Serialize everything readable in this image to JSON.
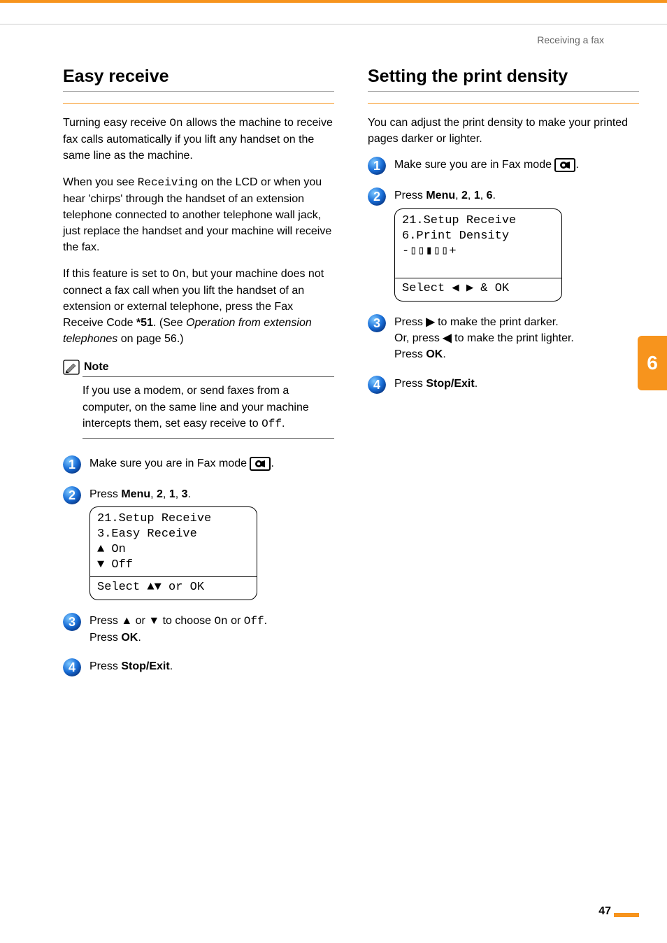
{
  "header": {
    "section": "Receiving a fax"
  },
  "left": {
    "title": "Easy receive",
    "p1a": "Turning easy receive ",
    "p1_on": "On",
    "p1b": " allows the machine to receive fax calls automatically if you lift any handset on the same line as the machine.",
    "p2a": "When you see ",
    "p2_rcv": "Receiving",
    "p2b": " on the LCD or when you hear 'chirps' through the handset of an extension telephone connected to another telephone wall jack, just replace the handset and your machine will receive the fax.",
    "p3a": "If this feature is set to ",
    "p3_on": "On",
    "p3b": ", but your machine does not connect a fax call when you lift the handset of an extension or external telephone, press the Fax Receive Code ",
    "p3_code": "*51",
    "p3c": ". (See ",
    "p3_link": "Operation from extension telephones",
    "p3d": " on page 56.)",
    "note_label": "Note",
    "note_a": "If you use a modem, or send faxes from a computer, on the same line and your machine intercepts them, set easy receive to ",
    "note_off": "Off",
    "note_b": ".",
    "s1": "Make sure you are in Fax mode ",
    "s2a": "Press ",
    "s2_menu": "Menu",
    "s2b": ", ",
    "s2_2": "2",
    "s2c": ", ",
    "s2_1": "1",
    "s2d": ", ",
    "s2_3": "3",
    "s2e": ".",
    "lcd1_l1": "21.Setup Receive",
    "lcd1_l2": "  3.Easy Receive",
    "lcd1_l3": "▲    On",
    "lcd1_l4": "▼    Off",
    "lcd1_l5": "Select ▲▼ or OK",
    "s3a": "Press ",
    "s3_up": "▲",
    "s3b": " or ",
    "s3_dn": "▼",
    "s3c": " to choose ",
    "s3_on": "On",
    "s3d": " or ",
    "s3_off": "Off",
    "s3e": ".",
    "s3f": "Press ",
    "s3_ok": "OK",
    "s3g": ".",
    "s4a": "Press ",
    "s4_stop": "Stop/Exit",
    "s4b": "."
  },
  "right": {
    "title": "Setting the print density",
    "p1": "You can adjust the print density to make your printed pages darker or lighter.",
    "s1": "Make sure you are in Fax mode ",
    "s2a": " Press ",
    "s2_menu": "Menu",
    "s2b": ", ",
    "s2_2": "2",
    "s2c": ", ",
    "s2_1": "1",
    "s2d": ", ",
    "s2_6": "6",
    "s2e": ".",
    "lcd_l1": "21.Setup Receive",
    "lcd_l2": "  6.Print Density",
    "lcd_l3": "      -▯▯▮▯▯+",
    "lcd_l4": "Select ◀ ▶ & OK",
    "s3a": "Press ",
    "s3_r": "▶",
    "s3b": " to make the print darker.",
    "s3c": "Or, press ",
    "s3_l": "◀",
    "s3d": " to make the print lighter.",
    "s3e": "Press ",
    "s3_ok": "OK",
    "s3f": ".",
    "s4a": "Press ",
    "s4_stop": "Stop/Exit",
    "s4b": "."
  },
  "tab": "6",
  "pagenum": "47"
}
